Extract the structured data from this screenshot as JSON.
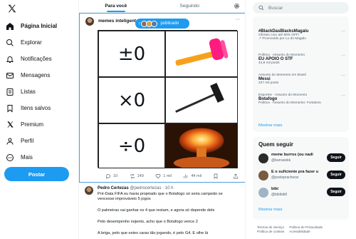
{
  "sidebar": {
    "items": [
      {
        "label": "Página Inicial",
        "icon": "home-icon",
        "active": true
      },
      {
        "label": "Explorar",
        "icon": "search-icon"
      },
      {
        "label": "Notificações",
        "icon": "bell-icon"
      },
      {
        "label": "Mensagens",
        "icon": "mail-icon"
      },
      {
        "label": "Listas",
        "icon": "list-icon"
      },
      {
        "label": "Itens salvos",
        "icon": "bookmark-icon"
      },
      {
        "label": "Premium",
        "icon": "x-logo-icon"
      },
      {
        "label": "Perfil",
        "icon": "person-icon"
      },
      {
        "label": "Mais",
        "icon": "more-circle-icon"
      }
    ],
    "post_label": "Postar"
  },
  "tabs": {
    "for_you": "Para você",
    "following": "Seguindo"
  },
  "tweet1": {
    "author": "memes inteligentes",
    "pill_label": "publicado",
    "meme": {
      "row1": "±0",
      "row2": "×0",
      "row3": "÷0"
    },
    "stats": {
      "replies": "10",
      "reposts": "149",
      "likes": "1 mil",
      "views": "44 mil"
    }
  },
  "tweet2": {
    "name": "Pedro Certezas",
    "handle": "@pedrocertezas · 10 h",
    "lines": [
      "Pré-Data FIFA eu havia projetado que o Botafogo só seria campeão se",
      "vencesse improváveis 5 jogos",
      "O palmeiras vai ganhar os 4 que restam, e agora só depende dele",
      "Pelo desempenho nojento, acho que o Botafogo vence 2",
      "A briga, pelo que estes caras tão jogando, é pelo G4. E olhe lá"
    ]
  },
  "search": {
    "placeholder": "Buscar"
  },
  "trends": [
    {
      "context": "",
      "title": "#BlackDasBlacksMagalu",
      "sub": "Ofertas com até 80% OFF!",
      "promo": "Promovido por Lu do Magalu"
    },
    {
      "context": "Política · Assunto do Momento",
      "title": "EU APOIO O STF",
      "sub": "44,8 mil posts"
    },
    {
      "context": "Assunto do Momento em Brasil",
      "title": "Messi",
      "sub": "227 mil posts"
    },
    {
      "context": "Esportes · Assunto do Momento",
      "title": "Botafogo",
      "sub": "Política · Assunto do Momento: Fortaleza"
    }
  ],
  "show_more": "Mostrar mais",
  "follow": {
    "title": "Quem seguir",
    "button_label": "Seguir",
    "users": [
      {
        "name": "meme burros (ou nadi",
        "handle": "@burraookk",
        "color": "#2b2b2b"
      },
      {
        "name": "É o suficiente pra fazer u",
        "handle": "@postsprachorar",
        "color": "#7a5a40"
      },
      {
        "name": "bibi",
        "handle": "@bibibib0",
        "color": "#a0b4c8"
      }
    ],
    "show_more": "Mostrar mais"
  },
  "footer": {
    "links": [
      "Termos de Serviço",
      "Política de Privacidade",
      "Política de cookies",
      "Acessibilidade"
    ]
  }
}
